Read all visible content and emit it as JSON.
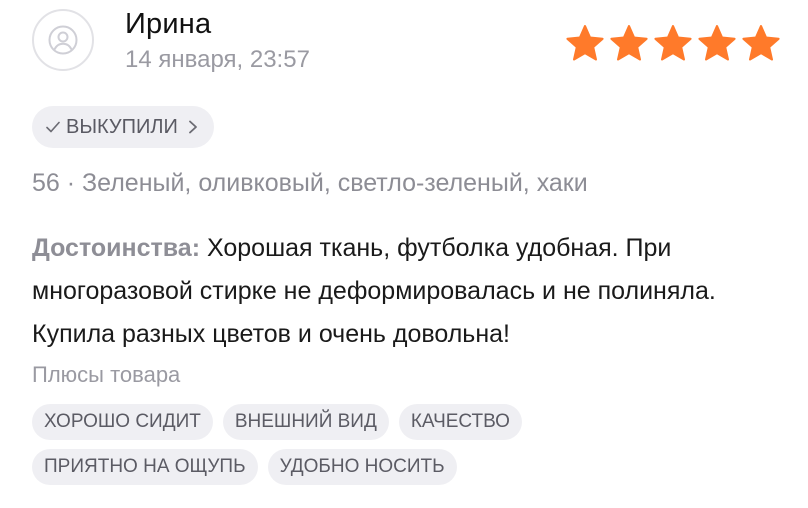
{
  "review": {
    "author": "Ирина",
    "date": "14 января, 23:57",
    "rating": 5,
    "rating_max": 5,
    "star_color": "#ff7a2a",
    "purchase_badge": "ВЫКУПИЛИ",
    "variant": "56 · Зеленый, оливковый, светло-зеленый, хаки",
    "pros_label": "Достоинства:",
    "pros_text": "Хорошая ткань, футболка удобная. При многоразовой стирке не деформировалась и не полиняла. Купила разных цветов и очень довольна!",
    "tags_heading": "Плюсы товара",
    "tags": [
      "ХОРОШО СИДИТ",
      "ВНЕШНИЙ ВИД",
      "КАЧЕСТВО",
      "ПРИЯТНО НА ОЩУПЬ",
      "УДОБНО НОСИТЬ"
    ]
  }
}
